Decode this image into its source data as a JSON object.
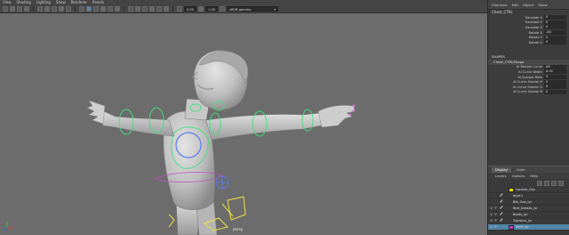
{
  "menubar": {
    "items": [
      "View",
      "Shading",
      "Lighting",
      "Show",
      "Renderer",
      "Panels"
    ]
  },
  "toolbar": {
    "field_a": "0.00",
    "field_b": "1.00",
    "colorspace": "sRGB gamma"
  },
  "viewport": {
    "camera_label": "persp"
  },
  "channel_box": {
    "menu": [
      "Channels",
      "Edit",
      "Object",
      "Show"
    ],
    "node_name": "Chest_CTRL",
    "attributes": [
      {
        "label": "Translate X",
        "value": "0"
      },
      {
        "label": "Translate Y",
        "value": "0"
      },
      {
        "label": "Translate Z",
        "value": "0"
      },
      {
        "label": "Rotate X",
        "value": "-40"
      },
      {
        "label": "Rotate Y",
        "value": "0"
      },
      {
        "label": "Rotate Z",
        "value": "0"
      }
    ],
    "shapes_header": "SHAPES",
    "shape_node": "Chest_CTRLShape",
    "shape_attributes": [
      {
        "label": "AI Render Curve",
        "value": "off"
      },
      {
        "label": "AI Curve Width",
        "value": "0.01"
      },
      {
        "label": "AI Sample Rate",
        "value": "5"
      },
      {
        "label": "AI Curve Shader R",
        "value": "0"
      },
      {
        "label": "AI Curve Shader G",
        "value": "0"
      },
      {
        "label": "AI Curve Shader B",
        "value": "0"
      }
    ]
  },
  "layer_panel": {
    "tabs": [
      "Display",
      "Anim"
    ],
    "menu": [
      "Layers",
      "Options",
      "Help"
    ],
    "layers": [
      {
        "name": "Locator_Grp",
        "v": "",
        "p": "",
        "color": "#f0e000",
        "pen": false
      },
      {
        "name": "layer1",
        "v": "",
        "p": "",
        "color": "",
        "pen": true
      },
      {
        "name": "Bib_Geo_lyr",
        "v": "",
        "p": "",
        "color": "",
        "pen": true
      },
      {
        "name": "Belt_Details_lyr",
        "v": "V",
        "p": "P",
        "color": "",
        "pen": true
      },
      {
        "name": "Boots_lyr",
        "v": "V",
        "p": "P",
        "color": "",
        "pen": true
      },
      {
        "name": "Trousers_lyr",
        "v": "V",
        "p": "P",
        "color": "",
        "pen": true
      },
      {
        "name": "Shirt_lyr",
        "v": "V",
        "p": "P",
        "color": "#c040c0",
        "pen": false
      }
    ]
  }
}
